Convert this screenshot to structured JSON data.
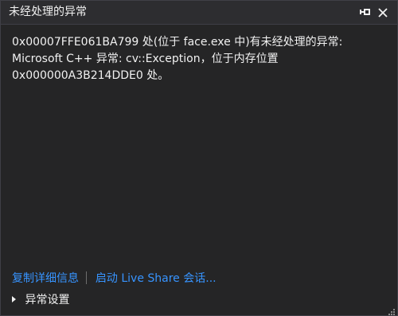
{
  "window": {
    "title": "未经处理的异常",
    "pin_icon": "pin-icon",
    "close_icon": "close-icon"
  },
  "message": {
    "lines": [
      "0x00007FFE061BA799 处(位于 face.exe 中)有未经处理的异常:",
      "Microsoft C++ 异常: cv::Exception，位于内存位置",
      "0x000000A3B214DDE0 处。"
    ]
  },
  "actions": {
    "copy_details": "复制详细信息",
    "live_share": "启动 Live Share 会话..."
  },
  "exception_settings": {
    "label": "异常设置",
    "expand_icon": "expand-triangle-icon"
  },
  "colors": {
    "background": "#252526",
    "text": "#f1f1f1",
    "link": "#3794ff",
    "border": "#3f3f46"
  }
}
